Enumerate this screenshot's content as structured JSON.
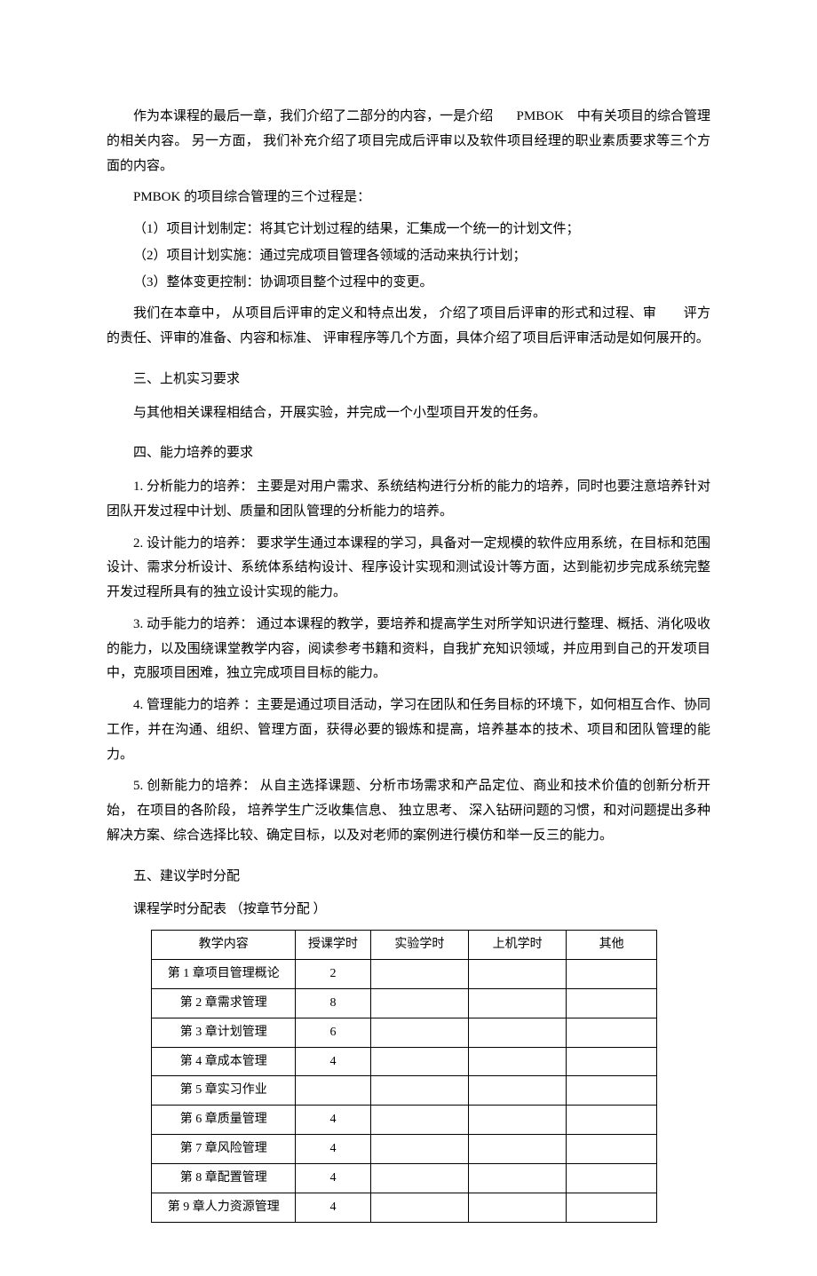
{
  "intro": {
    "p1_a": "作为本课程的最后一章，我们介绍了二部分的内容，一是介绍",
    "p1_b": "PMBOK",
    "p1_c": "中有关项目的综合管理的相关内容。 另一方面， 我们补充介绍了项目完成后评审以及软件项目经理的职业素质要求等三个方面的内容。",
    "p2": "PMBOK 的项目综合管理的三个过程是：",
    "li1": "（1）项目计划制定：将其它计划过程的结果，汇集成一个统一的计划文件；",
    "li2": "（2）项目计划实施：通过完成项目管理各领域的活动来执行计划；",
    "li3": "（3）整体变更控制：协调项目整个过程中的变更。",
    "p3": "我们在本章中， 从项目后评审的定义和特点出发， 介绍了项目后评审的形式和过程、审　　评方的责任、评审的准备、内容和标准、 评审程序等几个方面，具体介绍了项目后评审活动是如何展开的。"
  },
  "sec3": {
    "title": "三、上机实习要求",
    "p1": "与其他相关课程相结合，开展实验，并完成一个小型项目开发的任务。"
  },
  "sec4": {
    "title": "四、能力培养的要求",
    "p1": "1. 分析能力的培养： 主要是对用户需求、系统结构进行分析的能力的培养，同时也要注意培养针对团队开发过程中计划、质量和团队管理的分析能力的培养。",
    "p2": "2. 设计能力的培养： 要求学生通过本课程的学习，具备对一定规模的软件应用系统，在目标和范围设计、需求分析设计、系统体系结构设计、程序设计实现和测试设计等方面，达到能初步完成系统完整开发过程所具有的独立设计实现的能力。",
    "p3": "3. 动手能力的培养： 通过本课程的教学，要培养和提高学生对所学知识进行整理、概括、消化吸收的能力，以及围绕课堂教学内容，阅读参考书籍和资料，自我扩充知识领域，并应用到自己的开发项目中，克服项目困难，独立完成项目目标的能力。",
    "p4": "4. 管理能力的培养 ：主要是通过项目活动，学习在团队和任务目标的环境下，如何相互合作、协同工作，并在沟通、组织、管理方面，获得必要的锻炼和提高，培养基本的技术、项目和团队管理的能力。",
    "p5": "5. 创新能力的培养： 从自主选择课题、分析市场需求和产品定位、商业和技术价值的创新分析开始， 在项目的各阶段， 培养学生广泛收集信息、 独立思考、 深入钻研问题的习惯，和对问题提出多种解决方案、综合选择比较、确定目标，以及对老师的案例进行模仿和举一反三的能力。"
  },
  "sec5": {
    "title": "五、建议学时分配",
    "caption": "课程学时分配表 （按章节分配 ）",
    "headers": {
      "content": "教学内容",
      "lecture": "授课学时",
      "exp": "实验学时",
      "lab": "上机学时",
      "other": "其他"
    },
    "rows": [
      {
        "content": "第 1 章项目管理概论",
        "lecture": "2",
        "exp": "",
        "lab": "",
        "other": ""
      },
      {
        "content": "第 2 章需求管理",
        "lecture": "8",
        "exp": "",
        "lab": "",
        "other": ""
      },
      {
        "content": "第 3 章计划管理",
        "lecture": "6",
        "exp": "",
        "lab": "",
        "other": ""
      },
      {
        "content": "第 4 章成本管理",
        "lecture": "4",
        "exp": "",
        "lab": "",
        "other": ""
      },
      {
        "content": "第 5 章实习作业",
        "lecture": "",
        "exp": "",
        "lab": "",
        "other": ""
      },
      {
        "content": "第 6 章质量管理",
        "lecture": "4",
        "exp": "",
        "lab": "",
        "other": ""
      },
      {
        "content": "第 7 章风险管理",
        "lecture": "4",
        "exp": "",
        "lab": "",
        "other": ""
      },
      {
        "content": "第 8 章配置管理",
        "lecture": "4",
        "exp": "",
        "lab": "",
        "other": ""
      },
      {
        "content": "第 9 章人力资源管理",
        "lecture": "4",
        "exp": "",
        "lab": "",
        "other": ""
      }
    ]
  }
}
